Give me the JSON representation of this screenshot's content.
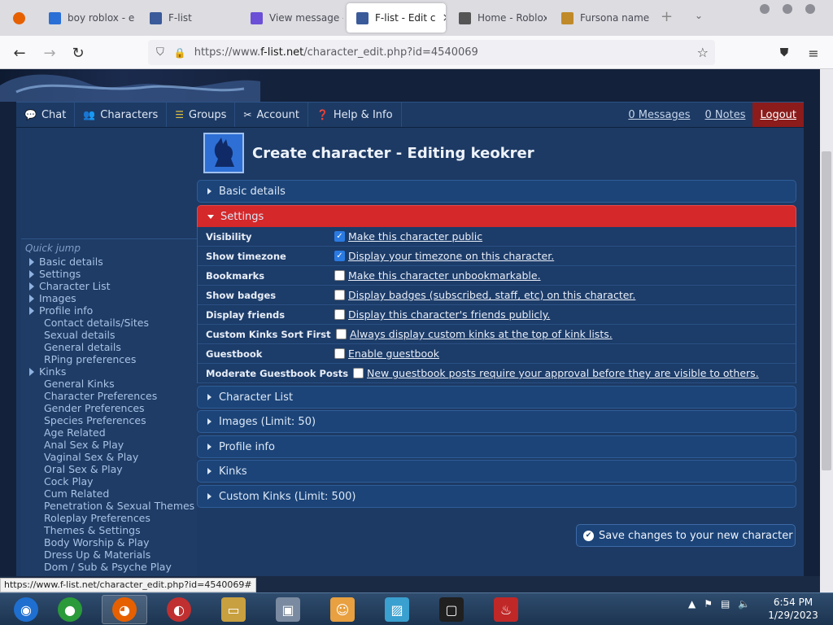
{
  "browser": {
    "tabs": [
      {
        "title": "boy roblox - e",
        "favicon": "edge-icon",
        "color": "#2a6fd6"
      },
      {
        "title": "F-list",
        "favicon": "flist-icon",
        "color": "#3a5a9a"
      },
      {
        "title": "View message -",
        "favicon": "chat-icon",
        "color": "#6b4fd6"
      },
      {
        "title": "F-list - Edit c",
        "favicon": "flist-icon",
        "color": "#3a5a9a"
      },
      {
        "title": "Home - Roblox",
        "favicon": "roblox-icon",
        "color": "#555555"
      },
      {
        "title": "Fursona names",
        "favicon": "f-icon",
        "color": "#c08a2a"
      }
    ],
    "active_tab_index": 3,
    "url_scheme": "https://www.",
    "url_host": "f-list.net",
    "url_path": "/character_edit.php?id=4540069"
  },
  "topnav": {
    "items": [
      {
        "label": "Chat",
        "icon": "speech-bubble-icon"
      },
      {
        "label": "Characters",
        "icon": "people-icon"
      },
      {
        "label": "Groups",
        "icon": "bars-icon"
      },
      {
        "label": "Account",
        "icon": "tools-icon"
      },
      {
        "label": "Help & Info",
        "icon": "help-icon"
      }
    ],
    "messages": "0 Messages",
    "notes": "0 Notes",
    "logout": "Logout"
  },
  "quickjump": {
    "title": "Quick jump",
    "items": [
      {
        "label": "Basic details",
        "level": 0
      },
      {
        "label": "Settings",
        "level": 0
      },
      {
        "label": "Character List",
        "level": 0
      },
      {
        "label": "Images",
        "level": 0
      },
      {
        "label": "Profile info",
        "level": 0
      },
      {
        "label": "Contact details/Sites",
        "level": 1
      },
      {
        "label": "Sexual details",
        "level": 1
      },
      {
        "label": "General details",
        "level": 1
      },
      {
        "label": "RPing preferences",
        "level": 1
      },
      {
        "label": "Kinks",
        "level": 0
      },
      {
        "label": "General Kinks",
        "level": 1
      },
      {
        "label": "Character Preferences",
        "level": 1
      },
      {
        "label": "Gender Preferences",
        "level": 1
      },
      {
        "label": "Species Preferences",
        "level": 1
      },
      {
        "label": "Age Related",
        "level": 1
      },
      {
        "label": "Anal Sex & Play",
        "level": 1
      },
      {
        "label": "Vaginal Sex & Play",
        "level": 1
      },
      {
        "label": "Oral Sex & Play",
        "level": 1
      },
      {
        "label": "Cock Play",
        "level": 1
      },
      {
        "label": "Cum Related",
        "level": 1
      },
      {
        "label": "Penetration & Sexual Themes",
        "level": 1
      },
      {
        "label": "Roleplay Preferences",
        "level": 1
      },
      {
        "label": "Themes & Settings",
        "level": 1
      },
      {
        "label": "Body Worship & Play",
        "level": 1
      },
      {
        "label": "Dress Up & Materials",
        "level": 1
      },
      {
        "label": "Dom / Sub & Psyche Play",
        "level": 1
      }
    ]
  },
  "page": {
    "title": "Create character - Editing keokrer"
  },
  "panels": {
    "basic": "Basic details",
    "settings": "Settings",
    "charlist": "Character List",
    "images": "Images (Limit: 50)",
    "profile": "Profile info",
    "kinks": "Kinks",
    "custom": "Custom Kinks (Limit: 500)"
  },
  "settings": [
    {
      "label": "Visibility",
      "text": "Make this character public",
      "checked": true
    },
    {
      "label": "Show timezone",
      "text": "Display your timezone on this character.",
      "checked": true
    },
    {
      "label": "Bookmarks",
      "text": "Make this character unbookmarkable.",
      "checked": false
    },
    {
      "label": "Show badges",
      "text": "Display badges (subscribed, staff, etc) on this character.",
      "checked": false
    },
    {
      "label": "Display friends",
      "text": "Display this character's friends publicly.",
      "checked": false
    },
    {
      "label": "Custom Kinks Sort First",
      "text": "Always display custom kinks at the top of kink lists.",
      "checked": false
    },
    {
      "label": "Guestbook",
      "text": "Enable guestbook",
      "checked": false
    },
    {
      "label": "Moderate Guestbook Posts",
      "text": "New guestbook posts require your approval before they are visible to others.",
      "checked": false
    }
  ],
  "save_button": "Save changes to your new character",
  "status_link": "https://www.f-list.net/character_edit.php?id=4540069#",
  "taskbar": {
    "apps": [
      "start-orb-icon",
      "chrome-icon",
      "firefox-icon",
      "obama-icon",
      "folder-icon",
      "monitor-icon",
      "user-icon",
      "photo-icon",
      "terminal-icon",
      "java-icon"
    ],
    "time": "6:54 PM",
    "date": "1/29/2023"
  }
}
